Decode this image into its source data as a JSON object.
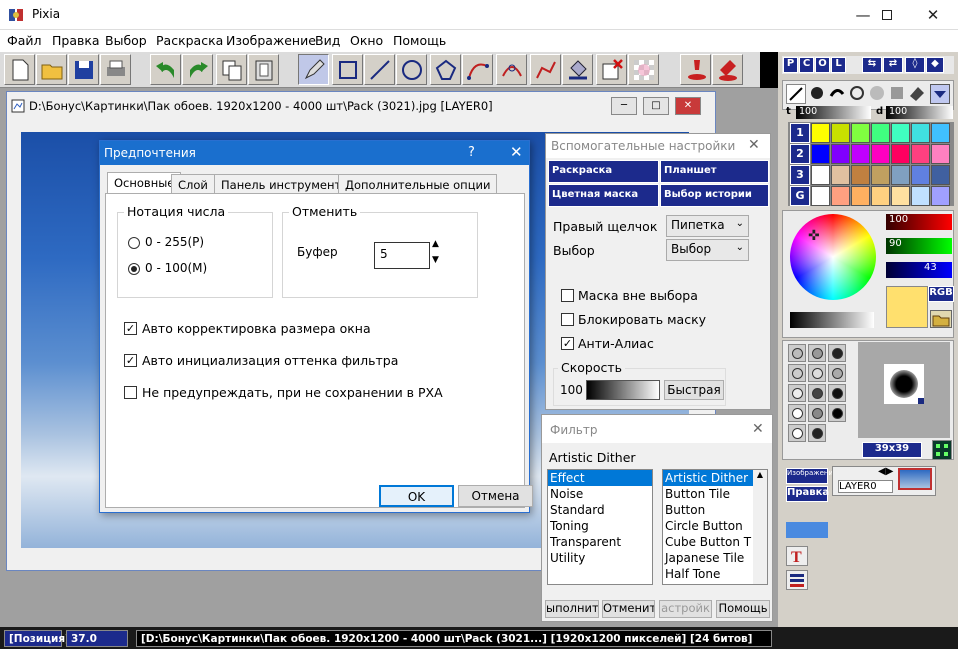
{
  "app": {
    "title": "Pixia"
  },
  "menu": [
    "Файл",
    "Правка",
    "Выбор",
    "Раскраска",
    "Изображение",
    "Вид",
    "Окно",
    "Помощь"
  ],
  "palette_tabs": [
    "P",
    "C",
    "O",
    "L"
  ],
  "palette_rows": [
    "1",
    "2",
    "3",
    "G"
  ],
  "right": {
    "opacity1_label": "t",
    "opacity1": "100",
    "opacity2_label": "d",
    "opacity2": "100",
    "r": "100",
    "g": "90",
    "b": "43",
    "rgb_label": "RGB",
    "brush_size": "39x39",
    "layer_tab": "Изображение",
    "layer_tab2": "Правка",
    "layer_name": "LAYER0"
  },
  "doc": {
    "title": "D:\\Бонус\\Картинки\\Пак обоев. 1920x1200 - 4000 шт\\Pack  (3021).jpg [LAYER0]"
  },
  "prefs": {
    "title": "Предпочтения",
    "help": "?",
    "tabs": [
      "Основные",
      "Слой",
      "Панель инструментов",
      "Дополнительные опции"
    ],
    "notation_group": "Нотация числа",
    "radio1": "0 - 255(P)",
    "radio2": "0 - 100(M)",
    "undo_group": "Отменить",
    "buffer_label": "Буфер",
    "buffer_value": "5",
    "chk1": "Авто корректировка размера окна",
    "chk2": "Авто инициализация оттенка фильтра",
    "chk3": "Не предупреждать, при не сохранении в PXA",
    "ok": "OK",
    "cancel": "Отмена"
  },
  "aux": {
    "title": "Вспомогательные настройки",
    "cells": [
      "Раскраска",
      "Планшет",
      "Цветная маска",
      "Выбор истории"
    ],
    "right_click_label": "Правый щелчок",
    "right_click_value": "Пипетка",
    "select_label": "Выбор",
    "select_value": "Выбор",
    "chk1": "Маска вне выбора",
    "chk2": "Блокировать маску",
    "chk3": "Анти-Алиас",
    "speed_label": "Скорость",
    "speed_value": "100",
    "speed_button": "Быстрая"
  },
  "filter": {
    "title": "Фильтр",
    "current": "Artistic Dither",
    "categories": [
      "Effect",
      "Noise",
      "Standard",
      "Toning",
      "Transparent",
      "Utility"
    ],
    "items": [
      "Artistic Dither",
      "Button Tile",
      "Button",
      "Circle Button",
      "Cube Button T",
      "Japanese Tile",
      "Half Tone"
    ],
    "buttons": [
      "ыполнит",
      "Отменит",
      "астройк",
      "Помощь"
    ]
  },
  "status": {
    "position_label": "[Позиция]",
    "value": "37.0",
    "info": "[D:\\Бонус\\Картинки\\Пак обоев. 1920x1200 - 4000 шт\\Pack  (3021...] [1920x1200 пикселей] [24 битов]"
  }
}
